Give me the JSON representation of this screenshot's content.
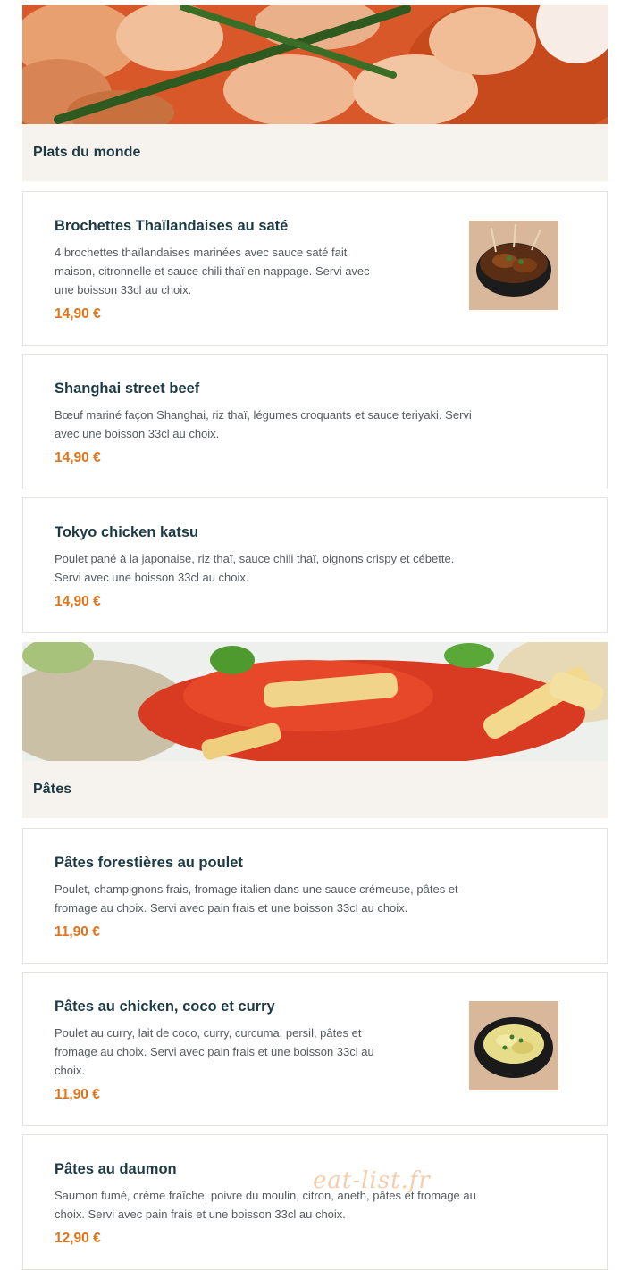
{
  "sections": [
    {
      "title": "Plats du monde",
      "banner_icon": "shrimp-dish-image",
      "items": [
        {
          "name": "Brochettes Thaïlandaises au saté",
          "description_lines": [
            "4 brochettes thaïlandaises marinées avec sauce saté fait",
            "maison, citronnelle et sauce chili thaï en nappage. Servi avec",
            "une boisson 33cl au choix."
          ],
          "price": "14,90 €",
          "has_photo": true
        },
        {
          "name": "Shanghai street beef",
          "description_lines": [
            "Bœuf mariné façon Shanghai, riz thaï, légumes croquants et sauce teriyaki. Servi",
            "avec une boisson 33cl au choix."
          ],
          "price": "14,90 €",
          "has_photo": false
        },
        {
          "name": "Tokyo chicken katsu",
          "description_lines": [
            "Poulet pané à la japonaise, riz thaï, sauce chili thaï, oignons crispy et cébette.",
            "Servi avec une boisson 33cl au choix."
          ],
          "price": "14,90 €",
          "has_photo": false
        }
      ]
    },
    {
      "title": "Pâtes",
      "banner_icon": "penne-pasta-image",
      "items": [
        {
          "name": "Pâtes forestières au poulet",
          "description_lines": [
            "Poulet, champignons frais, fromage italien dans une sauce crémeuse, pâtes et",
            "fromage au choix. Servi avec pain frais et une boisson 33cl au choix."
          ],
          "price": "11,90 €",
          "has_photo": false
        },
        {
          "name": "Pâtes au chicken, coco et curry",
          "description_lines": [
            "Poulet au curry, lait de coco, curry, curcuma, persil, pâtes et",
            "fromage au choix. Servi avec pain frais et une boisson 33cl au",
            "choix."
          ],
          "price": "11,90 €",
          "has_photo": true
        },
        {
          "name": "Pâtes au daumon",
          "description_lines": [
            "Saumon fumé, crème fraîche, poivre du moulin, citron, aneth, pâtes et fromage au",
            "choix. Servi avec pain frais et une boisson 33cl au choix."
          ],
          "price": "12,90 €",
          "has_photo": false
        }
      ]
    }
  ],
  "watermark": "eat-list.fr",
  "colors": {
    "title": "#1d3a44",
    "price": "#e0741c",
    "section_bg": "#f6f3ef",
    "border": "#e6e2dd"
  }
}
